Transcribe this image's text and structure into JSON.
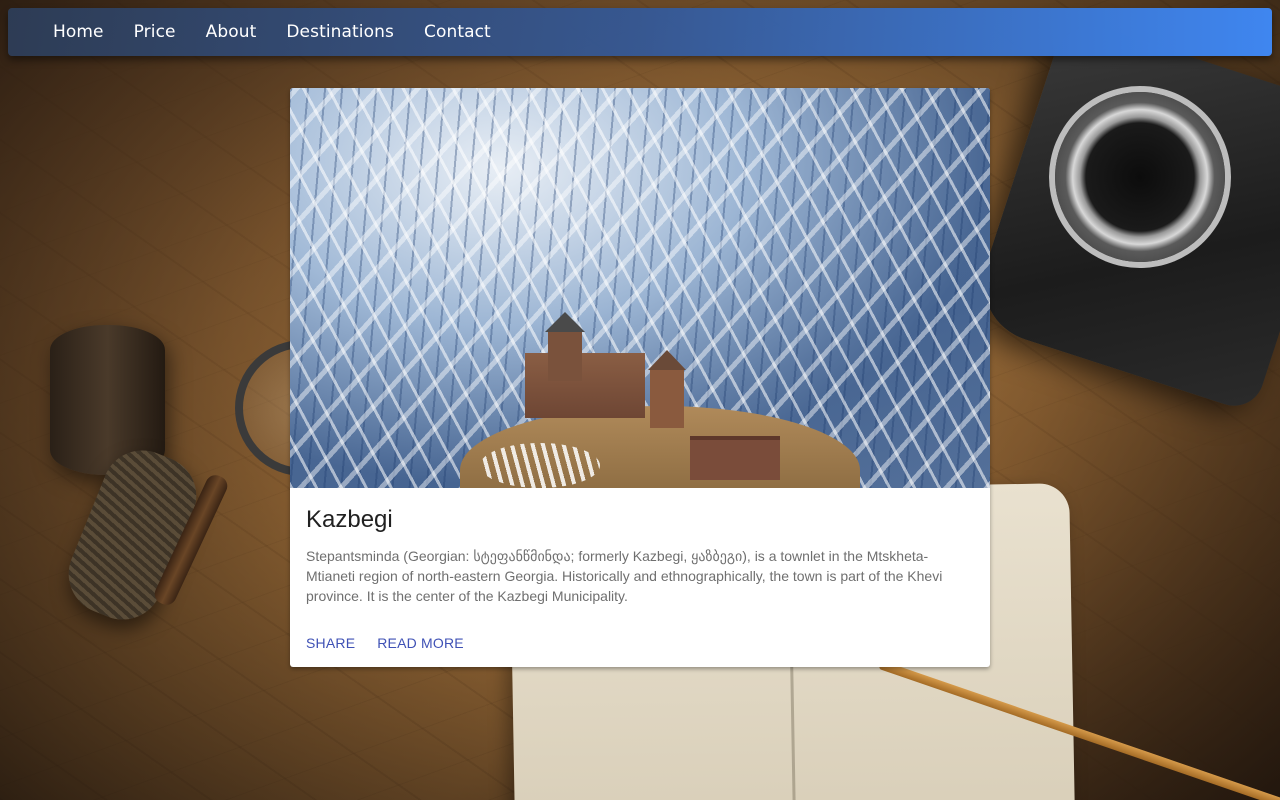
{
  "nav": {
    "items": [
      {
        "label": "Home"
      },
      {
        "label": "Price"
      },
      {
        "label": "About"
      },
      {
        "label": "Destinations"
      },
      {
        "label": "Contact"
      }
    ]
  },
  "card": {
    "title": "Kazbegi",
    "description": "Stepantsminda (Georgian: სტეფანწმინდა; formerly Kazbegi, ყაზბეგი), is a townlet in the Mtskheta-Mtianeti region of north-eastern Georgia. Historically and ethnographically, the town is part of the Khevi province. It is the center of the Kazbegi Municipality.",
    "actions": {
      "share": "SHARE",
      "read_more": "READ MORE"
    }
  },
  "colors": {
    "accent": "#3f51b5",
    "navbar_start": "#2d3e5a",
    "navbar_end": "#3f86f0"
  }
}
